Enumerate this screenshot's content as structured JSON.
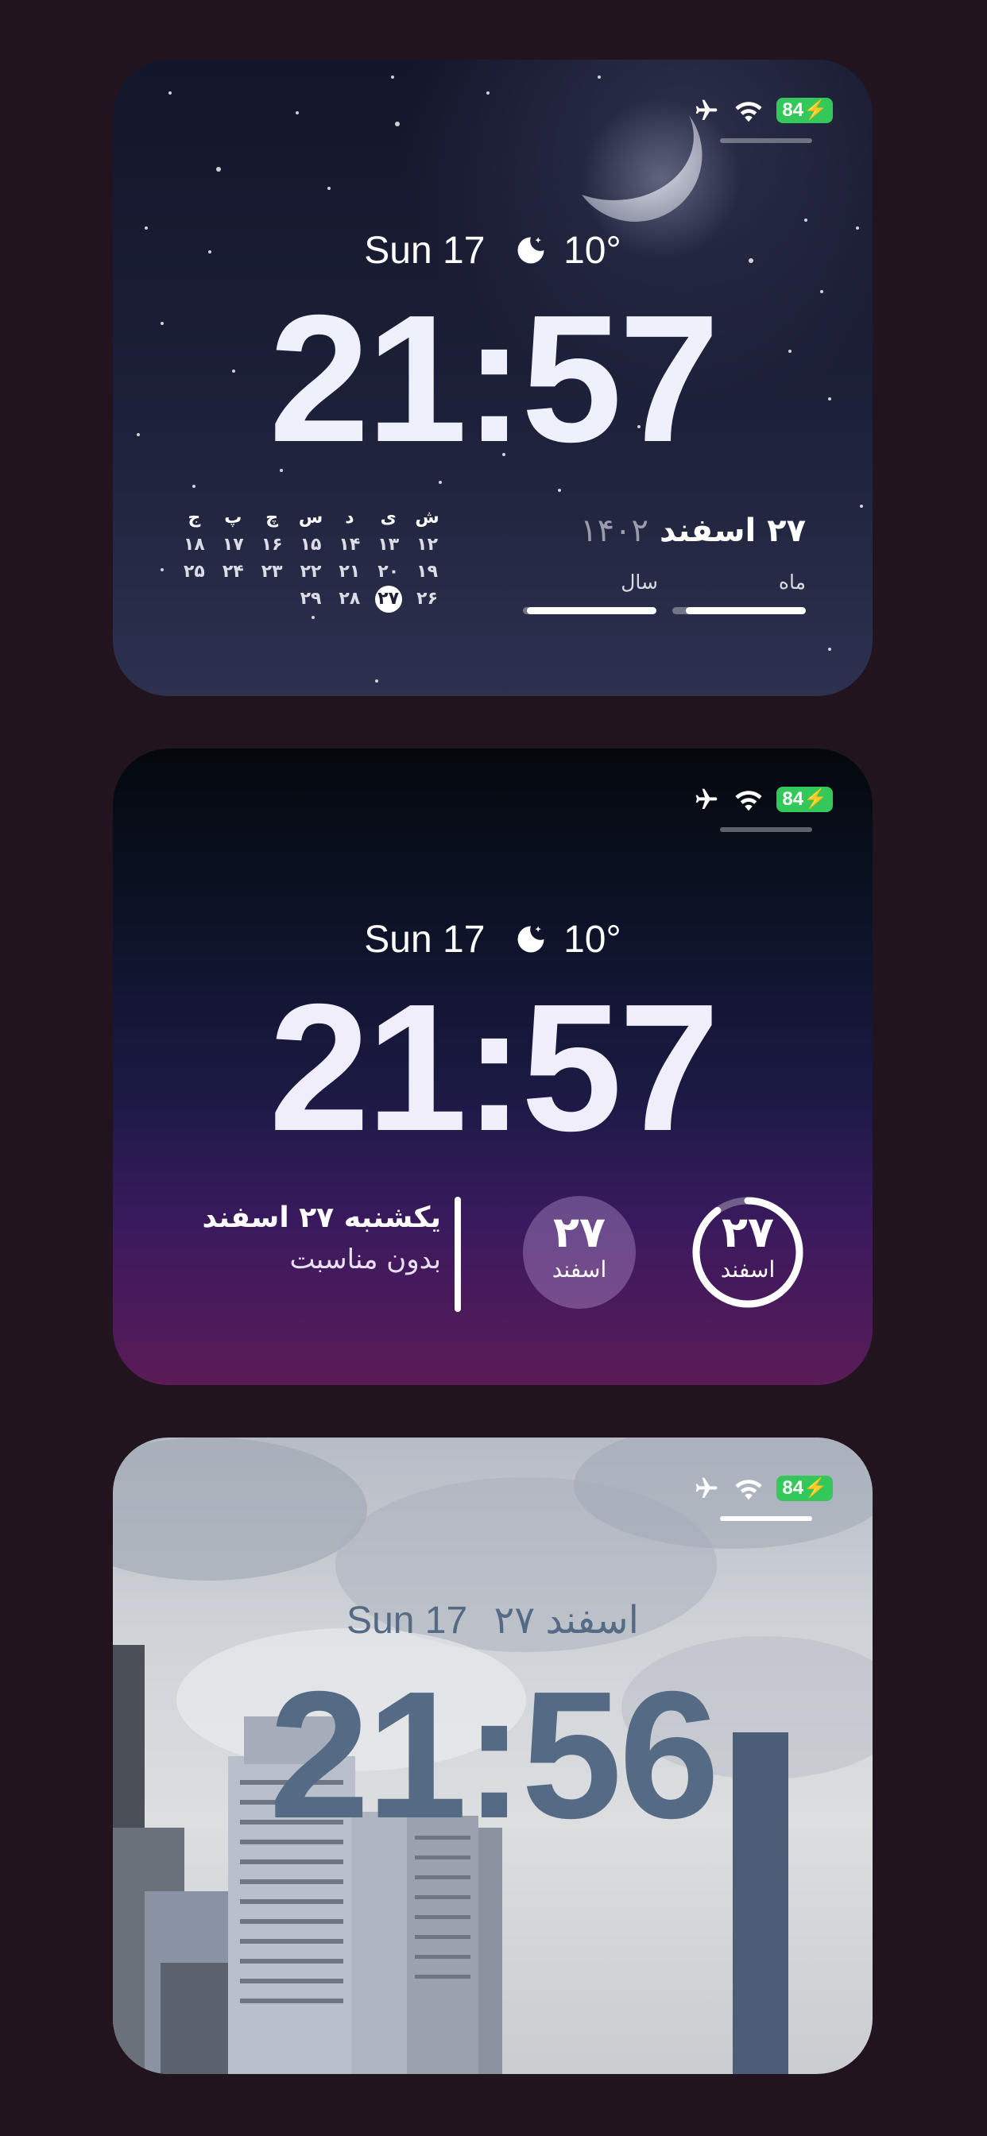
{
  "cards": [
    {
      "status": {
        "battery": "84"
      },
      "date_line": {
        "day": "Sun 17",
        "temp": "10°"
      },
      "time": "21:57",
      "calendar": {
        "headers": [
          "ش",
          "ی",
          "د",
          "س",
          "چ",
          "پ",
          "ج"
        ],
        "rows": [
          [
            "۱۲",
            "۱۳",
            "۱۴",
            "۱۵",
            "۱۶",
            "۱۷",
            "۱۸"
          ],
          [
            "۱۹",
            "۲۰",
            "۲۱",
            "۲۲",
            "۲۳",
            "۲۴",
            "۲۵"
          ],
          [
            "۲۶",
            "۲۷",
            "۲۸",
            "۲۹",
            "",
            "",
            ""
          ]
        ],
        "today": "۲۷"
      },
      "date_fa": {
        "day_month": "۲۷ اسفند",
        "year": "۱۴۰۲"
      },
      "progress": {
        "month_label": "ماه",
        "year_label": "سال",
        "month_value": 0.9,
        "year_value": 0.97
      }
    },
    {
      "status": {
        "battery": "84"
      },
      "date_line": {
        "day": "Sun 17",
        "temp": "10°"
      },
      "time": "21:57",
      "text_widget": {
        "line1": "یکشنبه ۲۷ اسفند",
        "line2": "بدون مناسبت"
      },
      "circle_fill": {
        "day": "۲۷",
        "month": "اسفند"
      },
      "circle_ring": {
        "day": "۲۷",
        "month": "اسفند",
        "value": 0.9
      }
    },
    {
      "status": {
        "battery": "84"
      },
      "date_line": {
        "day": "Sun 17",
        "fa_date": "۲۷ اسفند"
      },
      "time": "21:56"
    }
  ]
}
